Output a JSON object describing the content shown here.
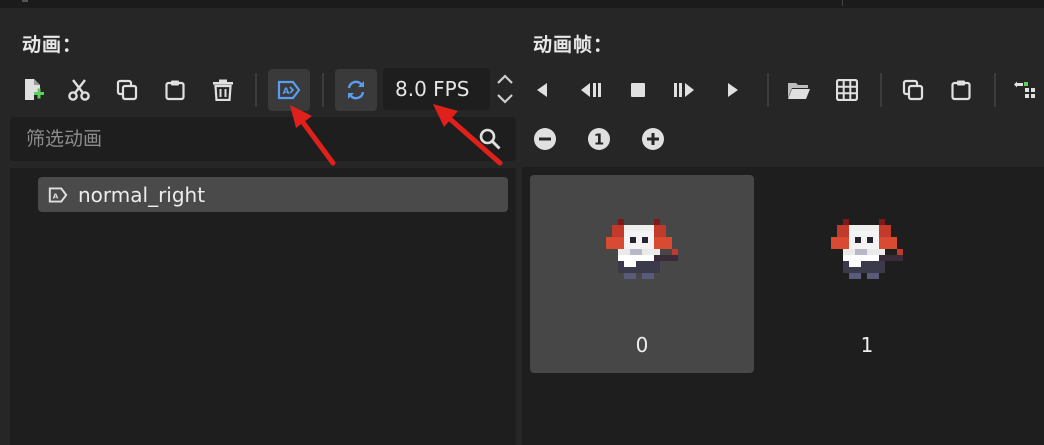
{
  "left_panel": {
    "title": "动画：",
    "toolbar": [
      {
        "name": "new-animation-button",
        "icon": "new-file-icon"
      },
      {
        "name": "cut-animation-button",
        "icon": "scissors-icon"
      },
      {
        "name": "copy-animation-button",
        "icon": "copy-icon"
      },
      {
        "name": "paste-animation-button",
        "icon": "paste-icon"
      },
      {
        "name": "delete-animation-button",
        "icon": "trash-icon"
      },
      {
        "name": "autoplay-on-load-button",
        "icon": "autoplay-icon",
        "active": true
      },
      {
        "name": "loop-animation-button",
        "icon": "loop-icon",
        "active": true
      }
    ],
    "fps_value": "8.0 FPS",
    "filter": {
      "placeholder": "筛选动画",
      "value": ""
    },
    "animations": [
      {
        "label": "normal_right",
        "icon": "animation-icon",
        "selected": true
      }
    ]
  },
  "right_panel": {
    "title": "动画帧：",
    "playback": [
      {
        "name": "play-backwards-from-end-button",
        "icon": "play-reverse-icon"
      },
      {
        "name": "play-backwards-button",
        "icon": "step-backward-icon"
      },
      {
        "name": "stop-button",
        "icon": "stop-icon"
      },
      {
        "name": "play-from-current-button",
        "icon": "step-forward-icon"
      },
      {
        "name": "play-forward-button",
        "icon": "play-icon"
      },
      {
        "name": "add-frames-from-file-button",
        "icon": "folder-icon"
      },
      {
        "name": "add-frames-from-spritesheet-button",
        "icon": "grid-icon"
      },
      {
        "name": "copy-frame-button",
        "icon": "copy-icon"
      },
      {
        "name": "paste-frame-button",
        "icon": "paste-icon"
      },
      {
        "name": "insert-frame-before-button",
        "icon": "insert-icon"
      }
    ],
    "zoom": [
      {
        "name": "zoom-out-button",
        "icon": "minus-circle-icon"
      },
      {
        "name": "zoom-reset-button",
        "icon": "one-circle-icon",
        "text": "1"
      },
      {
        "name": "zoom-in-button",
        "icon": "plus-circle-icon"
      }
    ],
    "frames": [
      {
        "index": "0",
        "selected": true
      },
      {
        "index": "1",
        "selected": false
      }
    ]
  },
  "colors": {
    "accent_blue": "#5a9cf0",
    "annotation_red": "#e0201b",
    "panel_bg": "#262626",
    "field_bg": "#1e1e1e"
  }
}
